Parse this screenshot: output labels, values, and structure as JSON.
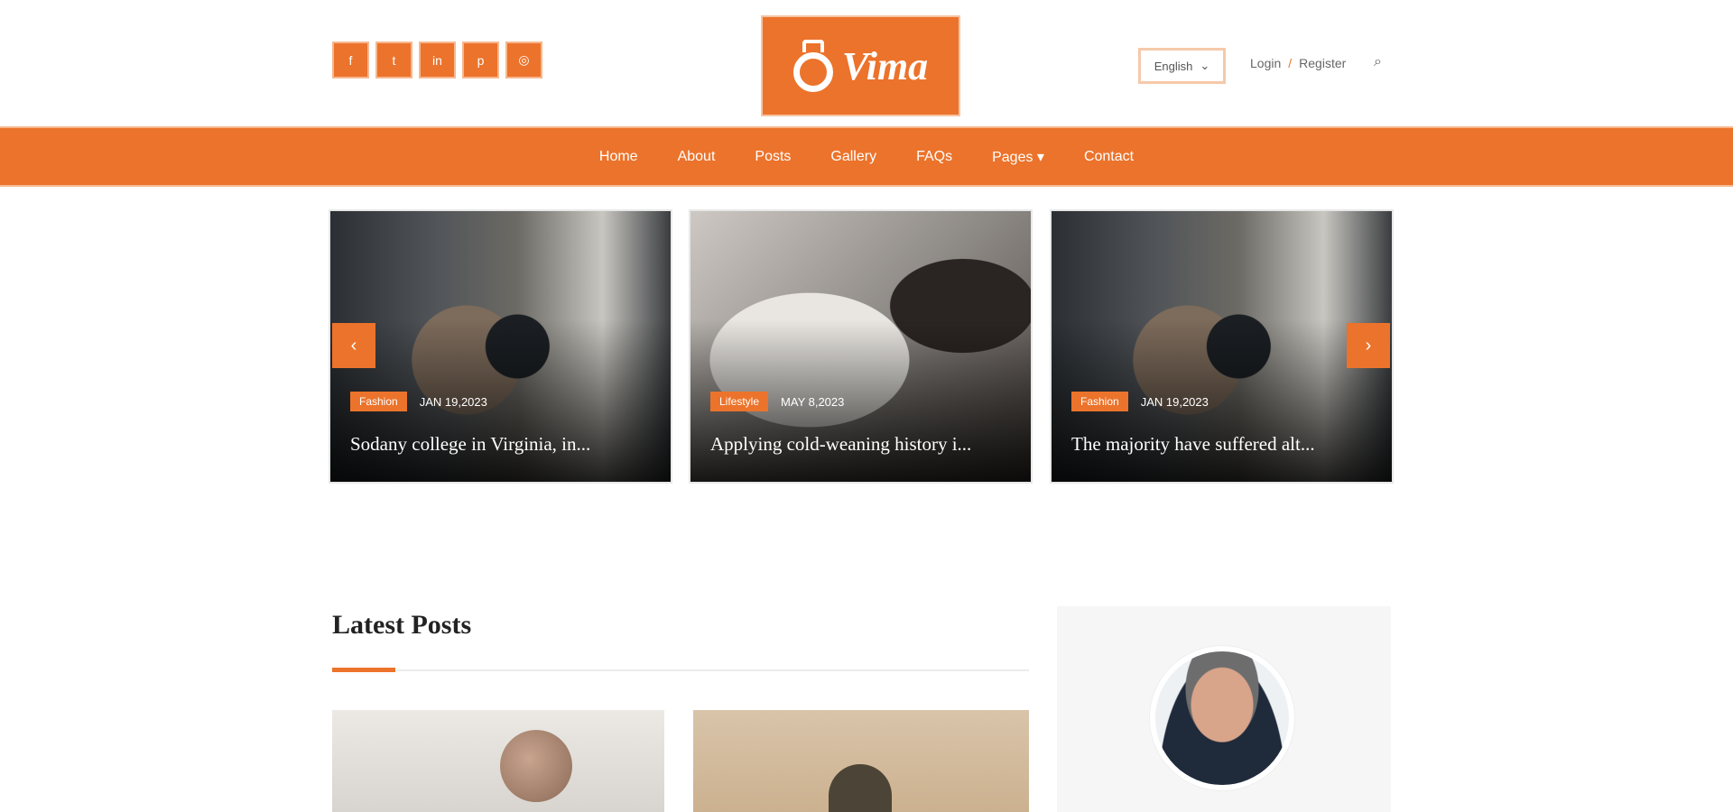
{
  "header": {
    "social_icons": [
      "facebook-icon",
      "twitter-icon",
      "linkedin-icon",
      "pinterest-icon",
      "instagram-icon"
    ],
    "social_glyphs": [
      "f",
      "t",
      "in",
      "p",
      "◎"
    ],
    "logo_text": "Vima",
    "language": {
      "selected": "English",
      "caret": "⌄"
    },
    "login_label": "Login",
    "auth_separator": "/",
    "register_label": "Register",
    "search_glyph": "⌕"
  },
  "nav": {
    "items": [
      "Home",
      "About",
      "Posts",
      "Gallery",
      "FAQs",
      "Pages ▾",
      "Contact"
    ]
  },
  "slider": {
    "prev_glyph": "‹",
    "next_glyph": "›",
    "slides": [
      {
        "category": "Fashion",
        "date": "JAN 19,2023",
        "title": "Sodany college in Virginia, in..."
      },
      {
        "category": "Lifestyle",
        "date": "MAY 8,2023",
        "title": "Applying cold-weaning history i..."
      },
      {
        "category": "Fashion",
        "date": "JAN 19,2023",
        "title": "The majority have suffered alt..."
      }
    ]
  },
  "latest": {
    "title": "Latest Posts"
  },
  "colors": {
    "accent": "#ec732b"
  }
}
